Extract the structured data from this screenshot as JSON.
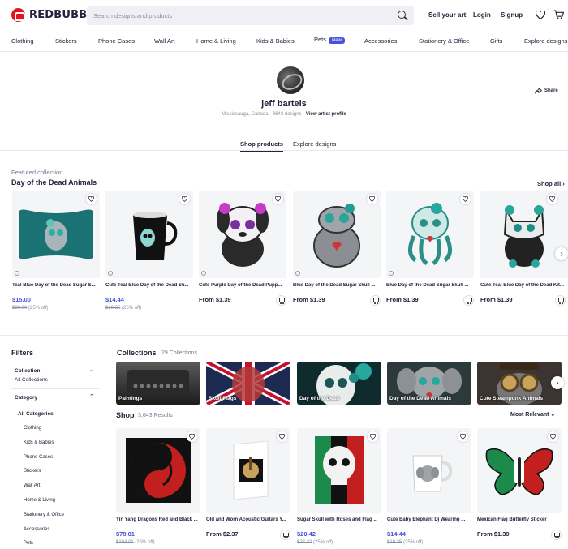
{
  "brand": {
    "name": "REDBUBBLE",
    "color": "#e41321"
  },
  "search": {
    "placeholder": "Search designs and products"
  },
  "header_links": {
    "sell": "Sell your art",
    "login": "Login",
    "signup": "Signup"
  },
  "nav": [
    {
      "label": "Clothing"
    },
    {
      "label": "Stickers"
    },
    {
      "label": "Phone Cases"
    },
    {
      "label": "Wall Art"
    },
    {
      "label": "Home & Living"
    },
    {
      "label": "Kids & Babies"
    },
    {
      "label": "Pets",
      "badge": "New"
    },
    {
      "label": "Accessories"
    },
    {
      "label": "Stationery & Office"
    },
    {
      "label": "Gifts"
    },
    {
      "label": "Explore designs"
    }
  ],
  "artist": {
    "name": "jeff bartels",
    "location": "Mississauga, Canada",
    "designs": "3643 designs",
    "profile_link": "View artist profile",
    "share_label": "Share"
  },
  "tabs": [
    {
      "label": "Shop products",
      "active": true
    },
    {
      "label": "Explore designs",
      "active": false
    }
  ],
  "featured": {
    "label": "Featured collection",
    "title": "Day of the Dead Animals",
    "shop_all": "Shop all",
    "products": [
      {
        "title": "Teal Blue Day of the Dead Sugar S...",
        "price": "$15.00",
        "old": "$20.00",
        "discount": "(25% off)"
      },
      {
        "title": "Cute Teal Blue Day of the Dead Su...",
        "price": "$14.44",
        "old": "$19.25",
        "discount": "(25% off)"
      },
      {
        "title": "Cute Purple Day of the Dead Pupp...",
        "price": "From $1.39"
      },
      {
        "title": "Blue Day of the Dead Sugar Skull ...",
        "price": "From $1.39"
      },
      {
        "title": "Blue Day of the Dead Sugar Skull ...",
        "price": "From $1.39"
      },
      {
        "title": "Cute Teal Blue Day of the Dead Kit...",
        "price": "From $1.39"
      }
    ]
  },
  "filters": {
    "title": "Filters",
    "collection": {
      "label": "Collection",
      "value": "All Collections"
    },
    "category": {
      "label": "Category",
      "all": "All Categories",
      "items": [
        "Clothing",
        "Kids & Babies",
        "Phone Cases",
        "Stickers",
        "Wall Art",
        "Home & Living",
        "Stationery & Office",
        "Accessories",
        "Pets"
      ]
    }
  },
  "collections": {
    "title": "Collections",
    "count": "29 Collections",
    "tiles": [
      "Paintings",
      "Skull Flags",
      "Day of the Dead",
      "Day of the Dead Animals",
      "Cute Steampunk Animals"
    ]
  },
  "shop": {
    "title": "Shop",
    "count": "3,643 Results",
    "sort": "Most Relevant",
    "products": [
      {
        "title": "Yin Yang Dragons Red and Black ...",
        "price": "$78.01",
        "old": "$104.01",
        "discount": "(25% off)"
      },
      {
        "title": "Old and Worn Acoustic Guitars Y...",
        "price": "From $2.37"
      },
      {
        "title": "Sugar Skull with Roses and Flag ...",
        "price": "$20.42",
        "old": "$27.22",
        "discount": "(25% off)"
      },
      {
        "title": "Cute Baby Elephant Dj Wearing ...",
        "price": "$14.44",
        "old": "$19.25",
        "discount": "(25% off)"
      },
      {
        "title": "Mexican Flag Butterfly Sticker",
        "price": "From $1.39"
      }
    ]
  },
  "colors": {
    "accent": "#4751dc",
    "text": "#22223a",
    "muted": "#8a8da0"
  }
}
